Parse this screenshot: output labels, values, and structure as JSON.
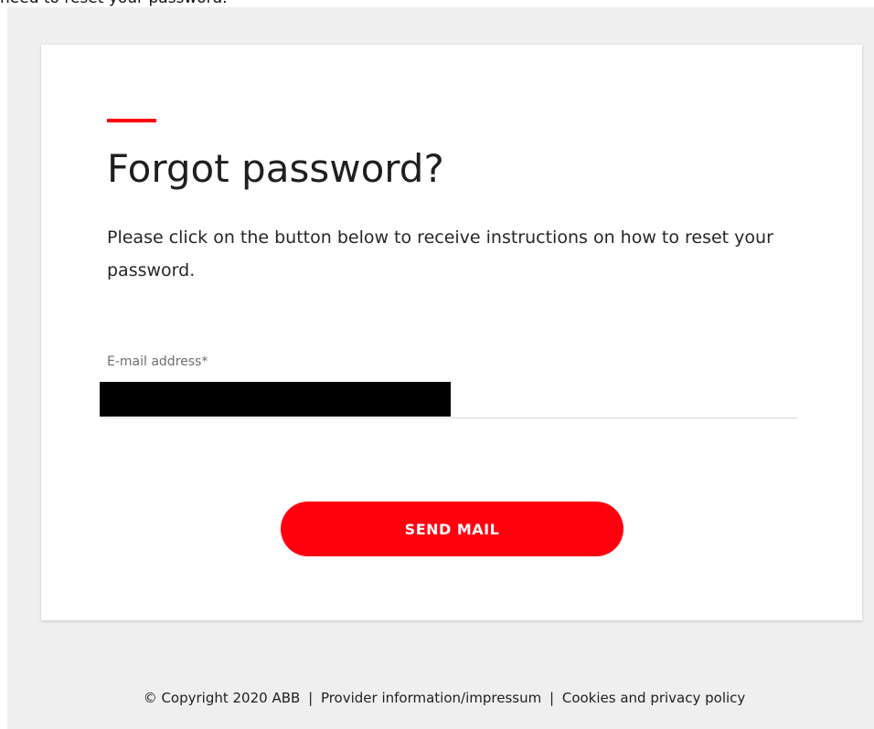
{
  "top_text": "need to reset your password.",
  "card": {
    "title": "Forgot password?",
    "description": "Please click on the button below to receive instructions on how to reset your password.",
    "email_label": "E-mail address*",
    "email_value": "",
    "send_button_label": "SEND MAIL"
  },
  "footer": {
    "copyright": "© Copyright 2020 ABB",
    "separator": "|",
    "provider_link": "Provider information/impressum",
    "cookies_link": "Cookies and privacy policy"
  },
  "colors": {
    "accent": "#ff000f",
    "background": "#efefef",
    "card": "#ffffff",
    "text": "#1f1f1f"
  }
}
